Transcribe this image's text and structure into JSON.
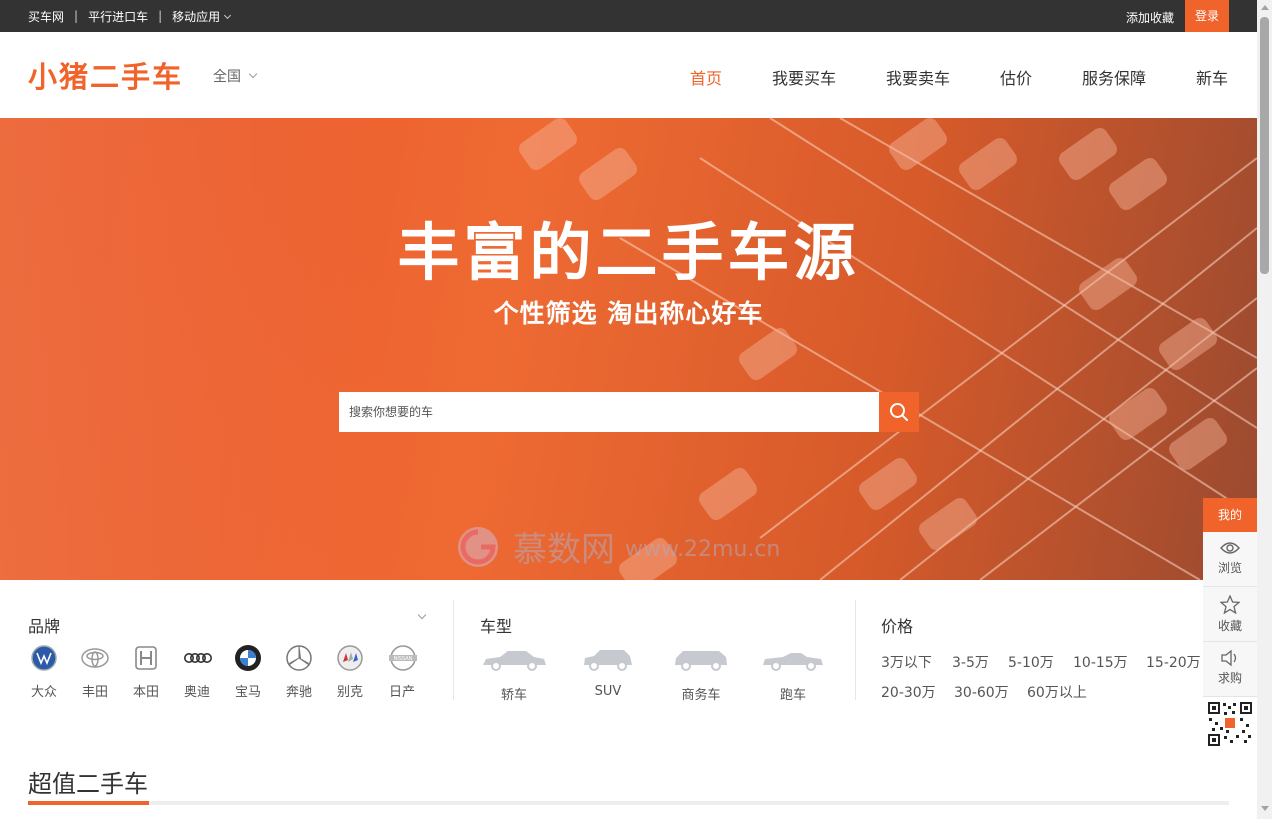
{
  "topbar": {
    "link_buy": "买车网",
    "link_import": "平行进口车",
    "link_mobile": "移动应用",
    "favorite": "添加收藏",
    "login": "登录"
  },
  "header": {
    "logo": "小猪二手车",
    "city": "全国",
    "nav": [
      "首页",
      "我要买车",
      "我要卖车",
      "估价",
      "服务保障",
      "新车"
    ],
    "active_nav": "首页"
  },
  "hero": {
    "title": "丰富的二手车源",
    "subtitle": "个性筛选 淘出称心好车",
    "search_placeholder": "搜索你想要的车",
    "watermark_text": "慕数网",
    "watermark_url": "www.22mu.cn"
  },
  "filters": {
    "brand_title": "品牌",
    "brands": [
      "大众",
      "丰田",
      "本田",
      "奥迪",
      "宝马",
      "奔驰",
      "别克",
      "日产"
    ],
    "type_title": "车型",
    "types": [
      "轿车",
      "SUV",
      "商务车",
      "跑车"
    ],
    "price_title": "价格",
    "prices": [
      "3万以下",
      "3-5万",
      "5-10万",
      "10-15万",
      "15-20万",
      "20-30万",
      "30-60万",
      "60万以上"
    ]
  },
  "section": {
    "title": "超值二手车"
  },
  "dock": {
    "mine": "我的",
    "browse": "浏览",
    "collect": "收藏",
    "request": "求购"
  },
  "colors": {
    "accent": "#f0632a",
    "topbar": "#333333"
  }
}
